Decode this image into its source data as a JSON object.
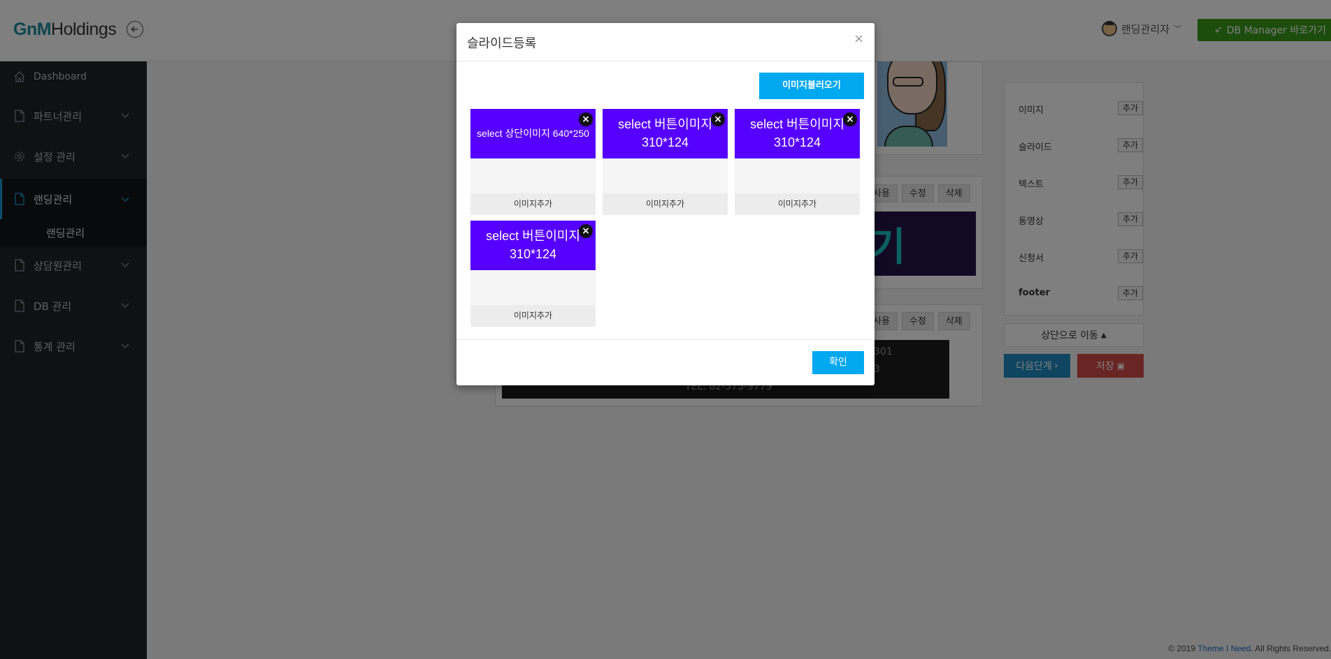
{
  "header": {
    "logo_g": "GnM",
    "logo_rest": "Holdings",
    "user_name": "랜딩관리자",
    "db_button_label": "DB Manager 바로가기"
  },
  "sidebar": {
    "items": [
      {
        "label": "Dashboard"
      },
      {
        "label": "파트너관리"
      },
      {
        "label": "설정 관리"
      },
      {
        "label": "랜딩관리"
      },
      {
        "label": "상담원관리"
      },
      {
        "label": "DB 관리"
      },
      {
        "label": "통계 관리"
      }
    ],
    "sub_item": "랜딩관리"
  },
  "background": {
    "row1_tools": [
      "사용",
      "수정",
      "삭제"
    ],
    "row2_tools": [
      "사용",
      "수정",
      "삭제"
    ],
    "banner_text": "기",
    "footer_line1": "301",
    "footer_line2": "3",
    "footer_line3": "TEL: 02-573-9779"
  },
  "right_panel": {
    "add_label": "추가",
    "items": [
      {
        "label": "이미지"
      },
      {
        "label": "슬라이드"
      },
      {
        "label": "텍스트"
      },
      {
        "label": "동영상"
      },
      {
        "label": "신청서"
      },
      {
        "label": "footer"
      }
    ],
    "top_button": "상단으로 이동",
    "next_button": "다음단계",
    "save_button": "저장"
  },
  "copyright": {
    "prefix": "© 2019 ",
    "link": "Theme I Need",
    "suffix": ". All Rights Reserved."
  },
  "modal": {
    "title": "슬라이드등록",
    "close_symbol": "×",
    "load_button": "이미지불러오기",
    "tiles": [
      {
        "image_text": "select 상단이미지 640*250",
        "add_label": "이미지추가"
      },
      {
        "image_text": "select 버튼이미지\n310*124",
        "add_label": "이미지추가"
      },
      {
        "image_text": "select 버튼이미지\n310*124",
        "add_label": "이미지추가"
      },
      {
        "image_text": "select 버튼이미지\n310*124",
        "add_label": "이미지추가"
      }
    ],
    "ok_button": "확인"
  },
  "colors": {
    "accent": "#00a8f0",
    "tile_image": "#5600ff",
    "sidebar": "#1e2327",
    "db_button": "#3a9a1a"
  }
}
